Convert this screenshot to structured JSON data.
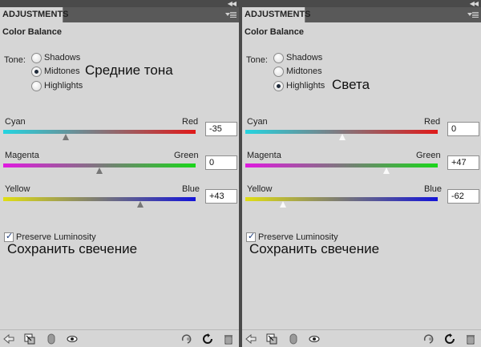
{
  "panels": [
    {
      "tab": "ADJUSTMENTS",
      "title": "Color Balance",
      "tone_label": "Tone:",
      "tones": [
        {
          "label": "Shadows",
          "checked": false
        },
        {
          "label": "Midtones",
          "checked": true
        },
        {
          "label": "Highlights",
          "checked": false
        }
      ],
      "annotation": "Средние тона",
      "sliders": [
        {
          "left": "Cyan",
          "right": "Red",
          "value": "-35",
          "level": -35
        },
        {
          "left": "Magenta",
          "right": "Green",
          "value": "0",
          "level": 0
        },
        {
          "left": "Yellow",
          "right": "Blue",
          "value": "+43",
          "level": 43
        }
      ],
      "preserve_label": "Preserve Luminosity",
      "preserve_checked": true,
      "preserve_annotation": "Сохранить свечение"
    },
    {
      "tab": "ADJUSTMENTS",
      "title": "Color Balance",
      "tone_label": "Tone:",
      "tones": [
        {
          "label": "Shadows",
          "checked": false
        },
        {
          "label": "Midtones",
          "checked": false
        },
        {
          "label": "Highlights",
          "checked": true
        }
      ],
      "annotation": "Света",
      "sliders": [
        {
          "left": "Cyan",
          "right": "Red",
          "value": "0",
          "level": 0
        },
        {
          "left": "Magenta",
          "right": "Green",
          "value": "+47",
          "level": 47
        },
        {
          "left": "Yellow",
          "right": "Blue",
          "value": "-62",
          "level": -62
        }
      ],
      "preserve_label": "Preserve Luminosity",
      "preserve_checked": true,
      "preserve_annotation": "Сохранить свечение"
    }
  ],
  "slider_gradients": [
    [
      "#25d4e0",
      "#e01a1a"
    ],
    [
      "#e01ae0",
      "#1ad61a"
    ],
    [
      "#e0de14",
      "#1414d8"
    ]
  ],
  "bottom_icons": [
    "back-arrow-icon",
    "clip-to-layer-icon",
    "visibility-toggle-icon",
    "eye-icon",
    "view-previous-state-icon",
    "reset-icon",
    "trash-icon"
  ]
}
